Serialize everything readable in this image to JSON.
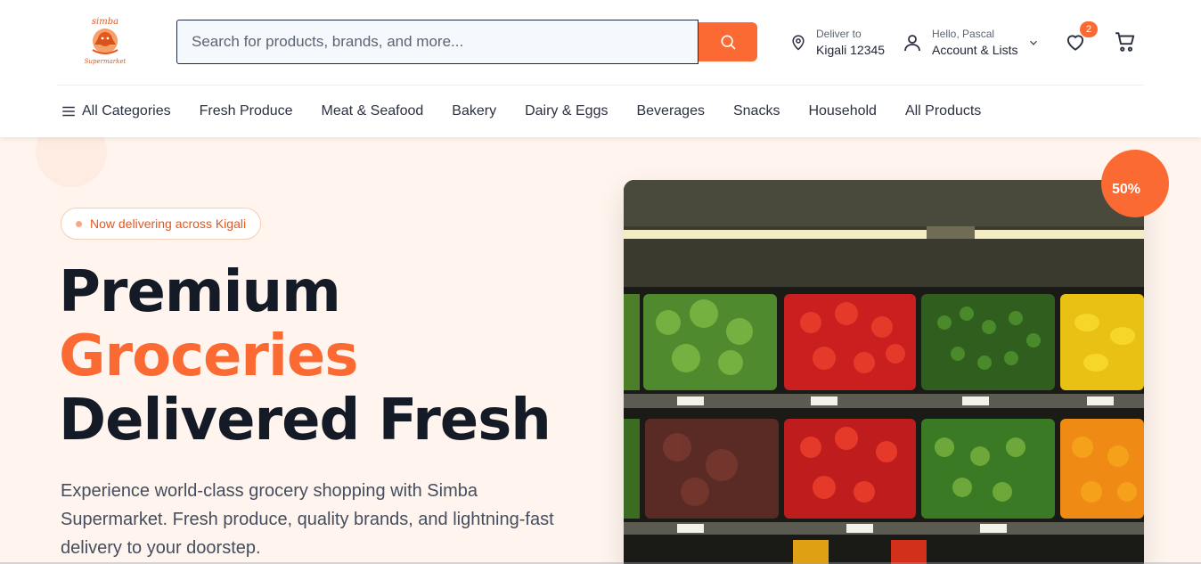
{
  "header": {
    "logo_text_top": "simba",
    "logo_text_bottom": "Supermarket",
    "search_placeholder": "Search for products, brands, and more...",
    "deliver_label": "Deliver to",
    "deliver_location": "Kigali 12345",
    "greeting": "Hello, Pascal",
    "account_label": "Account & Lists",
    "wishlist_count": "2",
    "accent_color": "#fb6a32"
  },
  "nav": {
    "items": [
      "All Categories",
      "Fresh Produce",
      "Meat & Seafood",
      "Bakery",
      "Dairy & Eggs",
      "Beverages",
      "Snacks",
      "Household",
      "All Products"
    ]
  },
  "hero": {
    "badge": "Now delivering across Kigali",
    "headline_line1": "Premium",
    "headline_line2": "Groceries",
    "headline_line3": "Delivered Fresh",
    "subtitle": "Experience world-class grocery shopping with Simba Supermarket. Fresh produce, quality brands, and lightning-fast delivery to your doorstep.",
    "discount": "50%",
    "image_subject": "produce-shelves-photo"
  },
  "icons": [
    "search-icon",
    "location-pin-icon",
    "user-icon",
    "chevron-down-icon",
    "heart-icon",
    "cart-icon",
    "menu-icon"
  ]
}
